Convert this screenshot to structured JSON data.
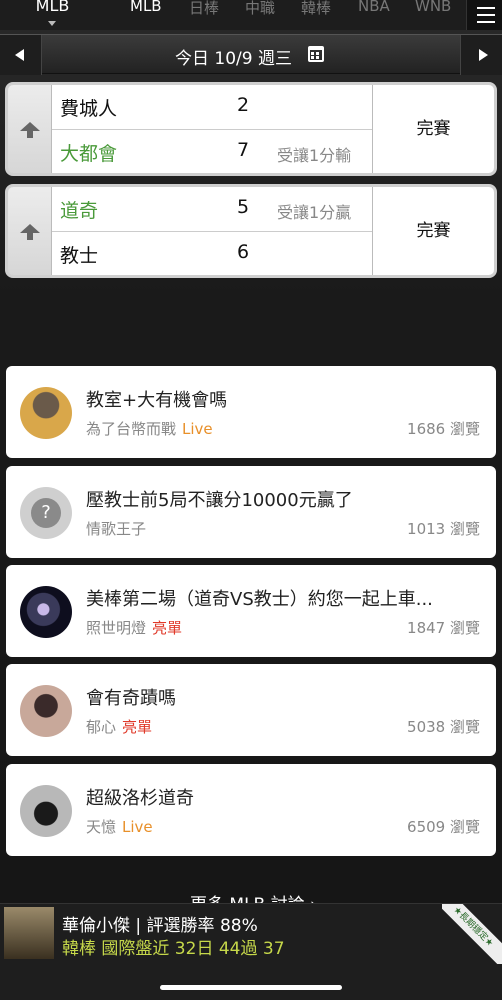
{
  "league_bar": {
    "selected_league": "MLB",
    "tabs": [
      "MLB",
      "日棒",
      "中職",
      "韓棒",
      "NBA",
      "WNB"
    ]
  },
  "date_bar": {
    "date_label": "今日 10/9 週三"
  },
  "games": [
    {
      "top": {
        "team": "費城人",
        "score": "2",
        "note": ""
      },
      "bottom": {
        "team": "大都會",
        "score": "7",
        "note": "受讓1分輸"
      },
      "status": "完賽"
    },
    {
      "top": {
        "team": "道奇",
        "score": "5",
        "note": "受讓1分贏"
      },
      "bottom": {
        "team": "教士",
        "score": "6",
        "note": ""
      },
      "status": "完賽"
    }
  ],
  "posts": [
    {
      "title": "教室+大有機會嗎",
      "author": "為了台幣而戰",
      "tag": "Live",
      "views": "1686 瀏覽"
    },
    {
      "title": "壓教士前5局不讓分10000元贏了",
      "author": "情歌王子",
      "tag": "",
      "views": "1013 瀏覽"
    },
    {
      "title": "美棒第二場（道奇VS教士）約您一起上車...",
      "author": "照世明燈",
      "tag": "亮單",
      "views": "1847 瀏覽"
    },
    {
      "title": "會有奇蹟嗎",
      "author": "郁心",
      "tag": "亮單",
      "views": "5038 瀏覽"
    },
    {
      "title": "超級洛杉道奇",
      "author": "天憶",
      "tag": "Live",
      "views": "6509 瀏覽"
    }
  ],
  "more_link": "更多 MLB 討論 ›",
  "banner": {
    "line1": "華倫小傑 | 評選勝率 88%",
    "line2": "韓棒 國際盤近 32日 44過 37",
    "corner_badge": "★長期穩定★"
  },
  "colors": {
    "green_team": "#4a9a3a",
    "live_tag": "#e8902a",
    "highlight_tag": "#e03a2a",
    "banner_stat": "#c6d84a"
  }
}
